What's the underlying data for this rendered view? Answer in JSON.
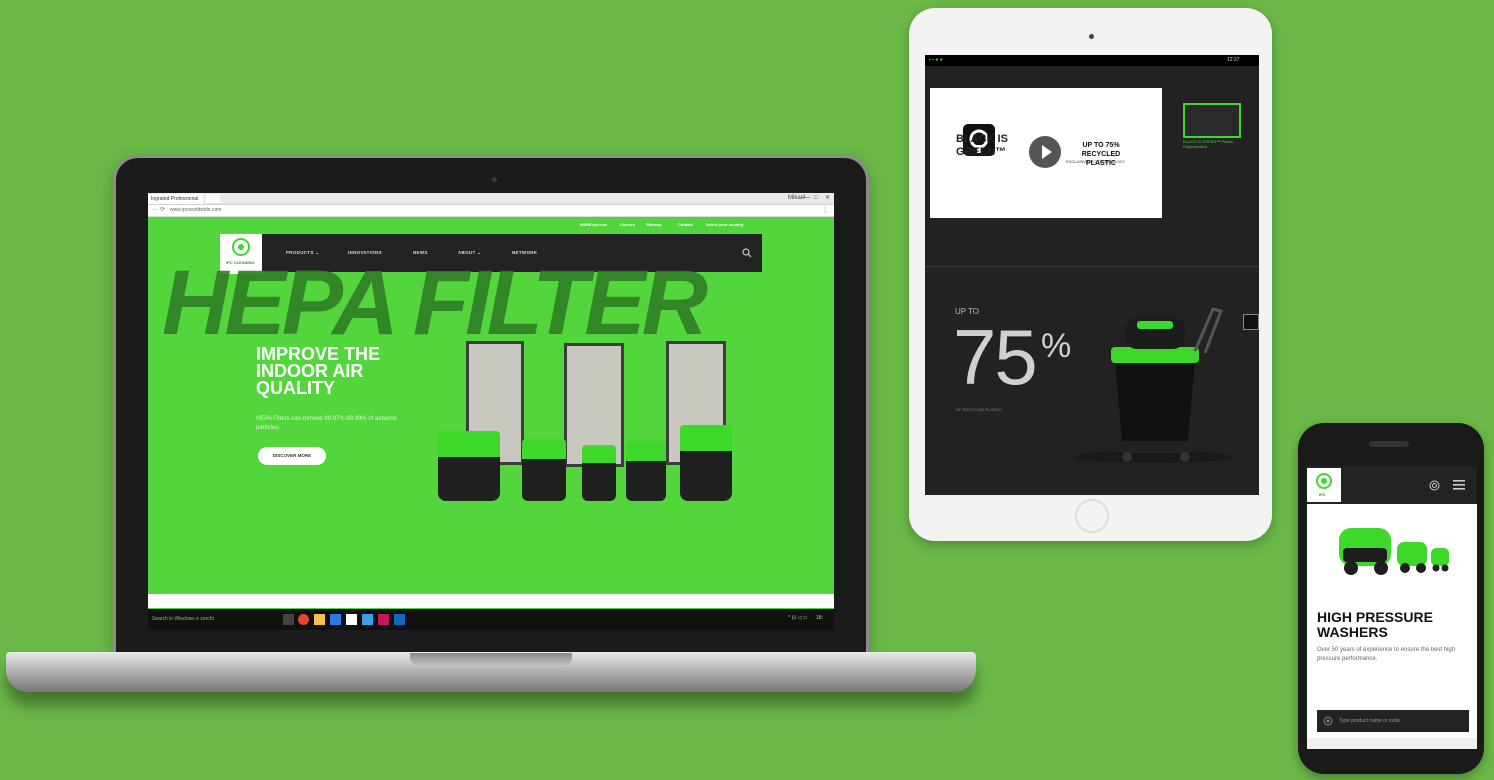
{
  "colors": {
    "background": "#6bb848",
    "brand_green": "#3ed82b",
    "dark": "#232323"
  },
  "laptop": {
    "browser": {
      "tab_title": "Ingrated Professional",
      "user_label": "Mikael",
      "address": "www.ipcworldwide.com",
      "window_controls": [
        "—",
        "□",
        "✕"
      ]
    },
    "top_links": [
      "WWW.ipc.com",
      "Careers",
      "Sitemap",
      "Contact",
      "Select your country"
    ],
    "nav": {
      "logo_text": "IPC CLEANING",
      "items": [
        "PRODUCTS ⌄",
        "INNOVATIONS",
        "NEWS",
        "ABOUT ⌄",
        "NETWORK"
      ],
      "search_icon": "search-icon"
    },
    "hero": {
      "background_text": "HEPA FILTER",
      "headline": "IMPROVE THE INDOOR AIR QUALITY",
      "subcopy": "HEPA Filters can remove 99.97% 99.99% of airborne particles.",
      "cta": "DISCOVER MORE"
    },
    "taskbar": {
      "search": "Search in Windows e cerchi",
      "clock": "18:"
    }
  },
  "tablet": {
    "status_time": "12:27",
    "video": {
      "brand": "BLACK IS GREEN™",
      "title": "UP TO 75% RECYCLED PLASTIC",
      "subtitle": "EXCLUSIVE IPC TECHNOLOGY"
    },
    "side_caption": "BLACK IS GREEN™ Plastic Regeneration",
    "stat": {
      "prefix": "UP TO",
      "value": "75",
      "unit": "%",
      "caption": "OF RECYCLED PLASTIC"
    }
  },
  "phone": {
    "logo_text": "IPC",
    "headline": "HIGH PRESSURE WASHERS",
    "copy": "Over 50 years of experience to ensure the best high pressure performance.",
    "search_placeholder": "Type product name or code"
  }
}
